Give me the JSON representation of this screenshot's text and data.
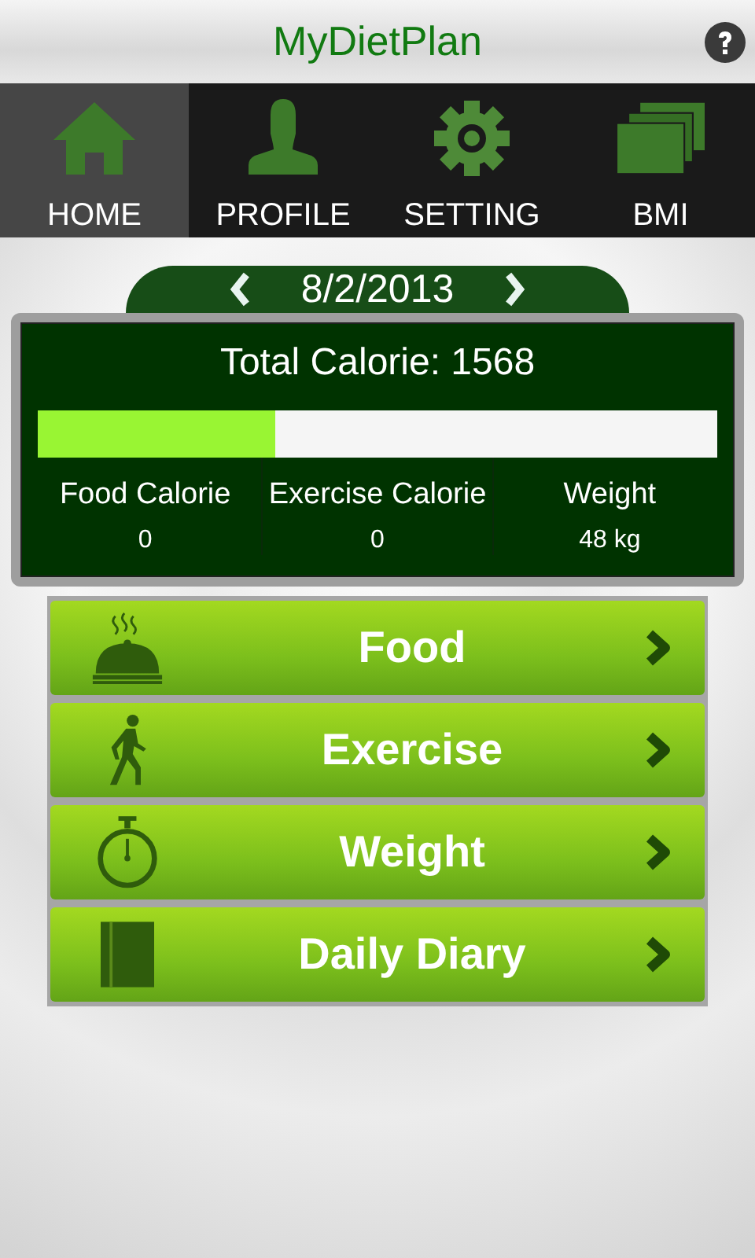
{
  "app_bar": {
    "title": "MyDietPlan"
  },
  "tabs": [
    {
      "label": "HOME",
      "kind": "home",
      "selected": true
    },
    {
      "label": "PROFILE",
      "kind": "profile",
      "selected": false
    },
    {
      "label": "SETTING",
      "kind": "setting",
      "selected": false
    },
    {
      "label": "BMI",
      "kind": "bmi",
      "selected": false
    }
  ],
  "date": "8/2/2013",
  "summary": {
    "title": "Total Calorie: 1568",
    "level": 0.35,
    "stats": [
      {
        "label": "Food Calorie",
        "value": "0"
      },
      {
        "label": "Exercise Calorie",
        "value": "0"
      },
      {
        "label": "Weight",
        "value": "48 kg"
      }
    ]
  },
  "menu": [
    {
      "label": "Food",
      "kind": "food"
    },
    {
      "label": "Exercise",
      "kind": "exercise"
    },
    {
      "label": "Weight",
      "kind": "weight"
    },
    {
      "label": "Daily Diary",
      "kind": "diary"
    }
  ]
}
